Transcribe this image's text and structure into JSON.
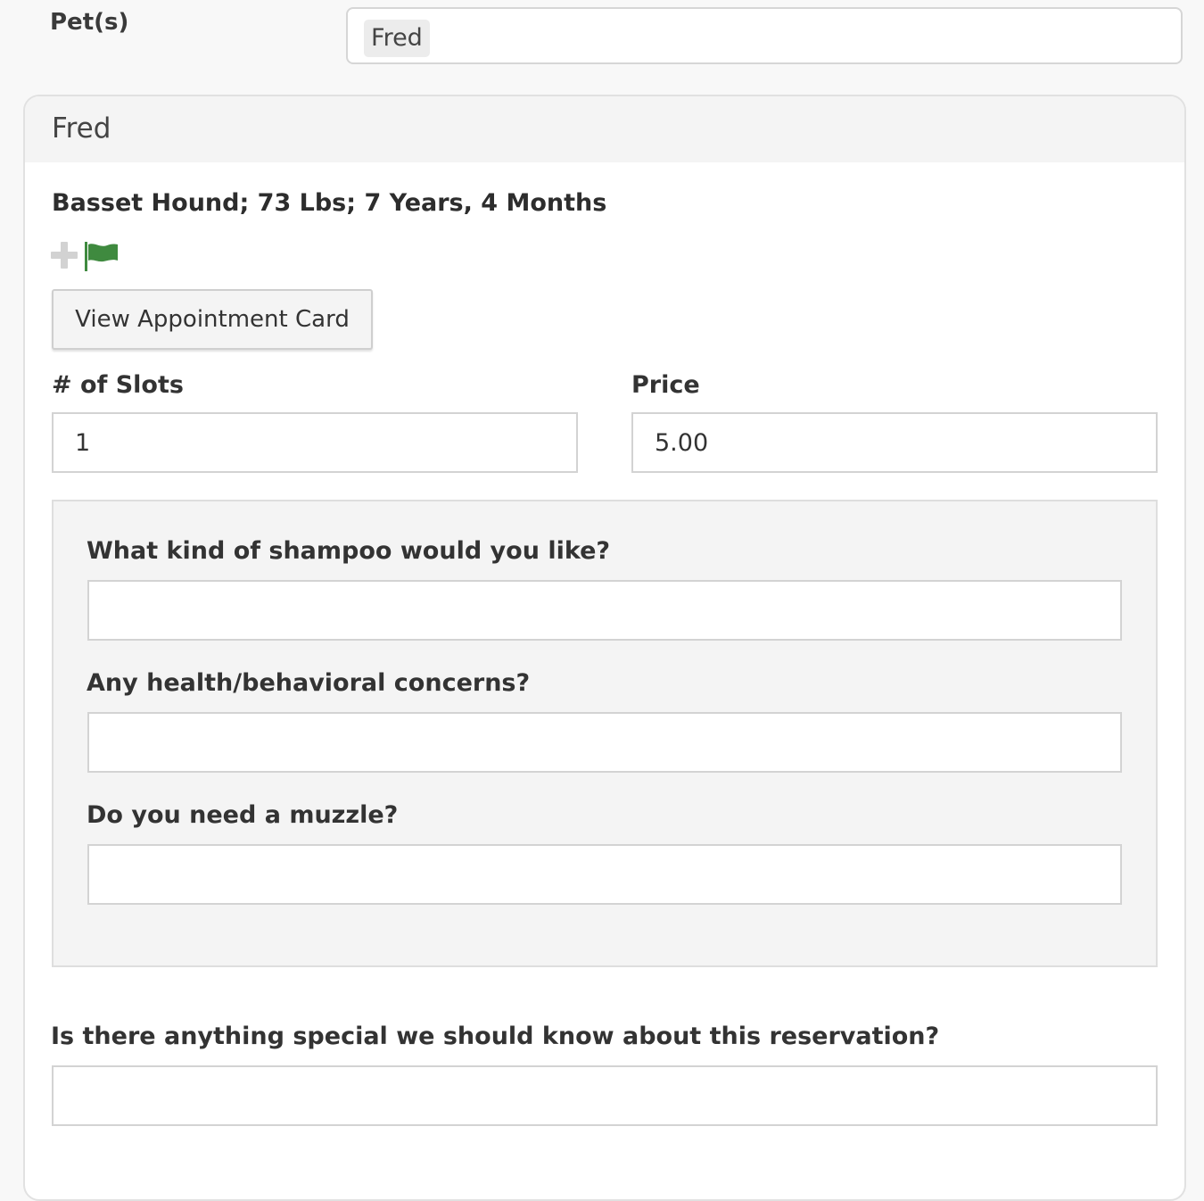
{
  "pets": {
    "label": "Pet(s)",
    "selected": [
      "Fred"
    ]
  },
  "panel": {
    "title": "Fred",
    "summary": "Basset Hound; 73 Lbs; 7 Years, 4 Months",
    "icons": [
      "plus-icon",
      "flag-icon"
    ],
    "flag_color": "#3f8a3f",
    "view_card_label": "View Appointment Card",
    "slots": {
      "label": "# of Slots",
      "value": "1"
    },
    "price": {
      "label": "Price",
      "value": "5.00"
    },
    "questions": [
      {
        "label": "What kind of shampoo would you like?",
        "value": ""
      },
      {
        "label": "Any health/behavioral concerns?",
        "value": ""
      },
      {
        "label": "Do you need a muzzle?",
        "value": ""
      }
    ],
    "special": {
      "label": "Is there anything special we should know about this reservation?",
      "value": ""
    }
  }
}
